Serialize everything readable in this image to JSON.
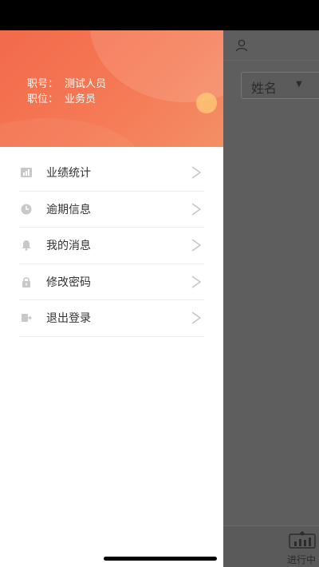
{
  "profile": {
    "job_no_label": "职号：",
    "job_no_value": "测试人员",
    "position_label": "职位：",
    "position_value": "业务员"
  },
  "menu": {
    "items": [
      {
        "label": "业绩统计",
        "icon": "bar-chart-icon"
      },
      {
        "label": "逾期信息",
        "icon": "clock-icon"
      },
      {
        "label": "我的消息",
        "icon": "bell-icon"
      },
      {
        "label": "修改密码",
        "icon": "lock-icon"
      },
      {
        "label": "退出登录",
        "icon": "logout-icon"
      }
    ]
  },
  "background": {
    "filter_label": "姓名",
    "bottom_tab_label": "进行中"
  },
  "colors": {
    "header_start": "#f26a4b",
    "header_end": "#f48f66",
    "overlay": "#5a5a5a"
  }
}
